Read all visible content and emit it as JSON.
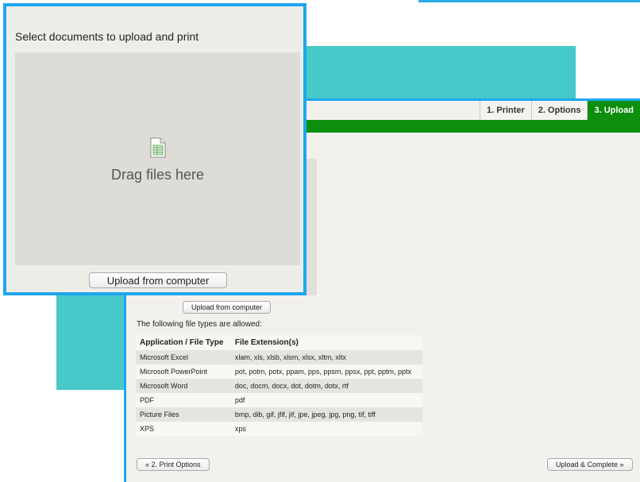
{
  "wizard": {
    "tabs": [
      {
        "label": "1. Printer",
        "active": false
      },
      {
        "label": "2. Options",
        "active": false
      },
      {
        "label": "3. Upload",
        "active": true
      }
    ],
    "upload_from_computer_label": "Upload from computer",
    "allowed_text": "The following file types are allowed:",
    "table": {
      "headers": [
        "Application / File Type",
        "File Extension(s)"
      ],
      "rows": [
        [
          "Microsoft Excel",
          "xlam, xls, xlsb, xlsm, xlsx, xltm, xltx"
        ],
        [
          "Microsoft PowerPoint",
          "pot, potm, potx, ppam, pps, ppsm, ppsx, ppt, pptm, pptx"
        ],
        [
          "Microsoft Word",
          "doc, docm, docx, dot, dotm, dotx, rtf"
        ],
        [
          "PDF",
          "pdf"
        ],
        [
          "Picture Files",
          "bmp, dib, gif, jfif, jif, jpe, jpeg, jpg, png, tif, tiff"
        ],
        [
          "XPS",
          "xps"
        ]
      ]
    },
    "back_button_label": "« 2. Print Options",
    "complete_button_label": "Upload & Complete »"
  },
  "popup": {
    "title": "Select documents to upload and print",
    "drag_label": "Drag files here",
    "upload_button_label": "Upload from computer"
  },
  "colors": {
    "accent_blue": "#1ea6ef",
    "teal": "#47c9c9",
    "active_green": "#0d8f0d"
  }
}
